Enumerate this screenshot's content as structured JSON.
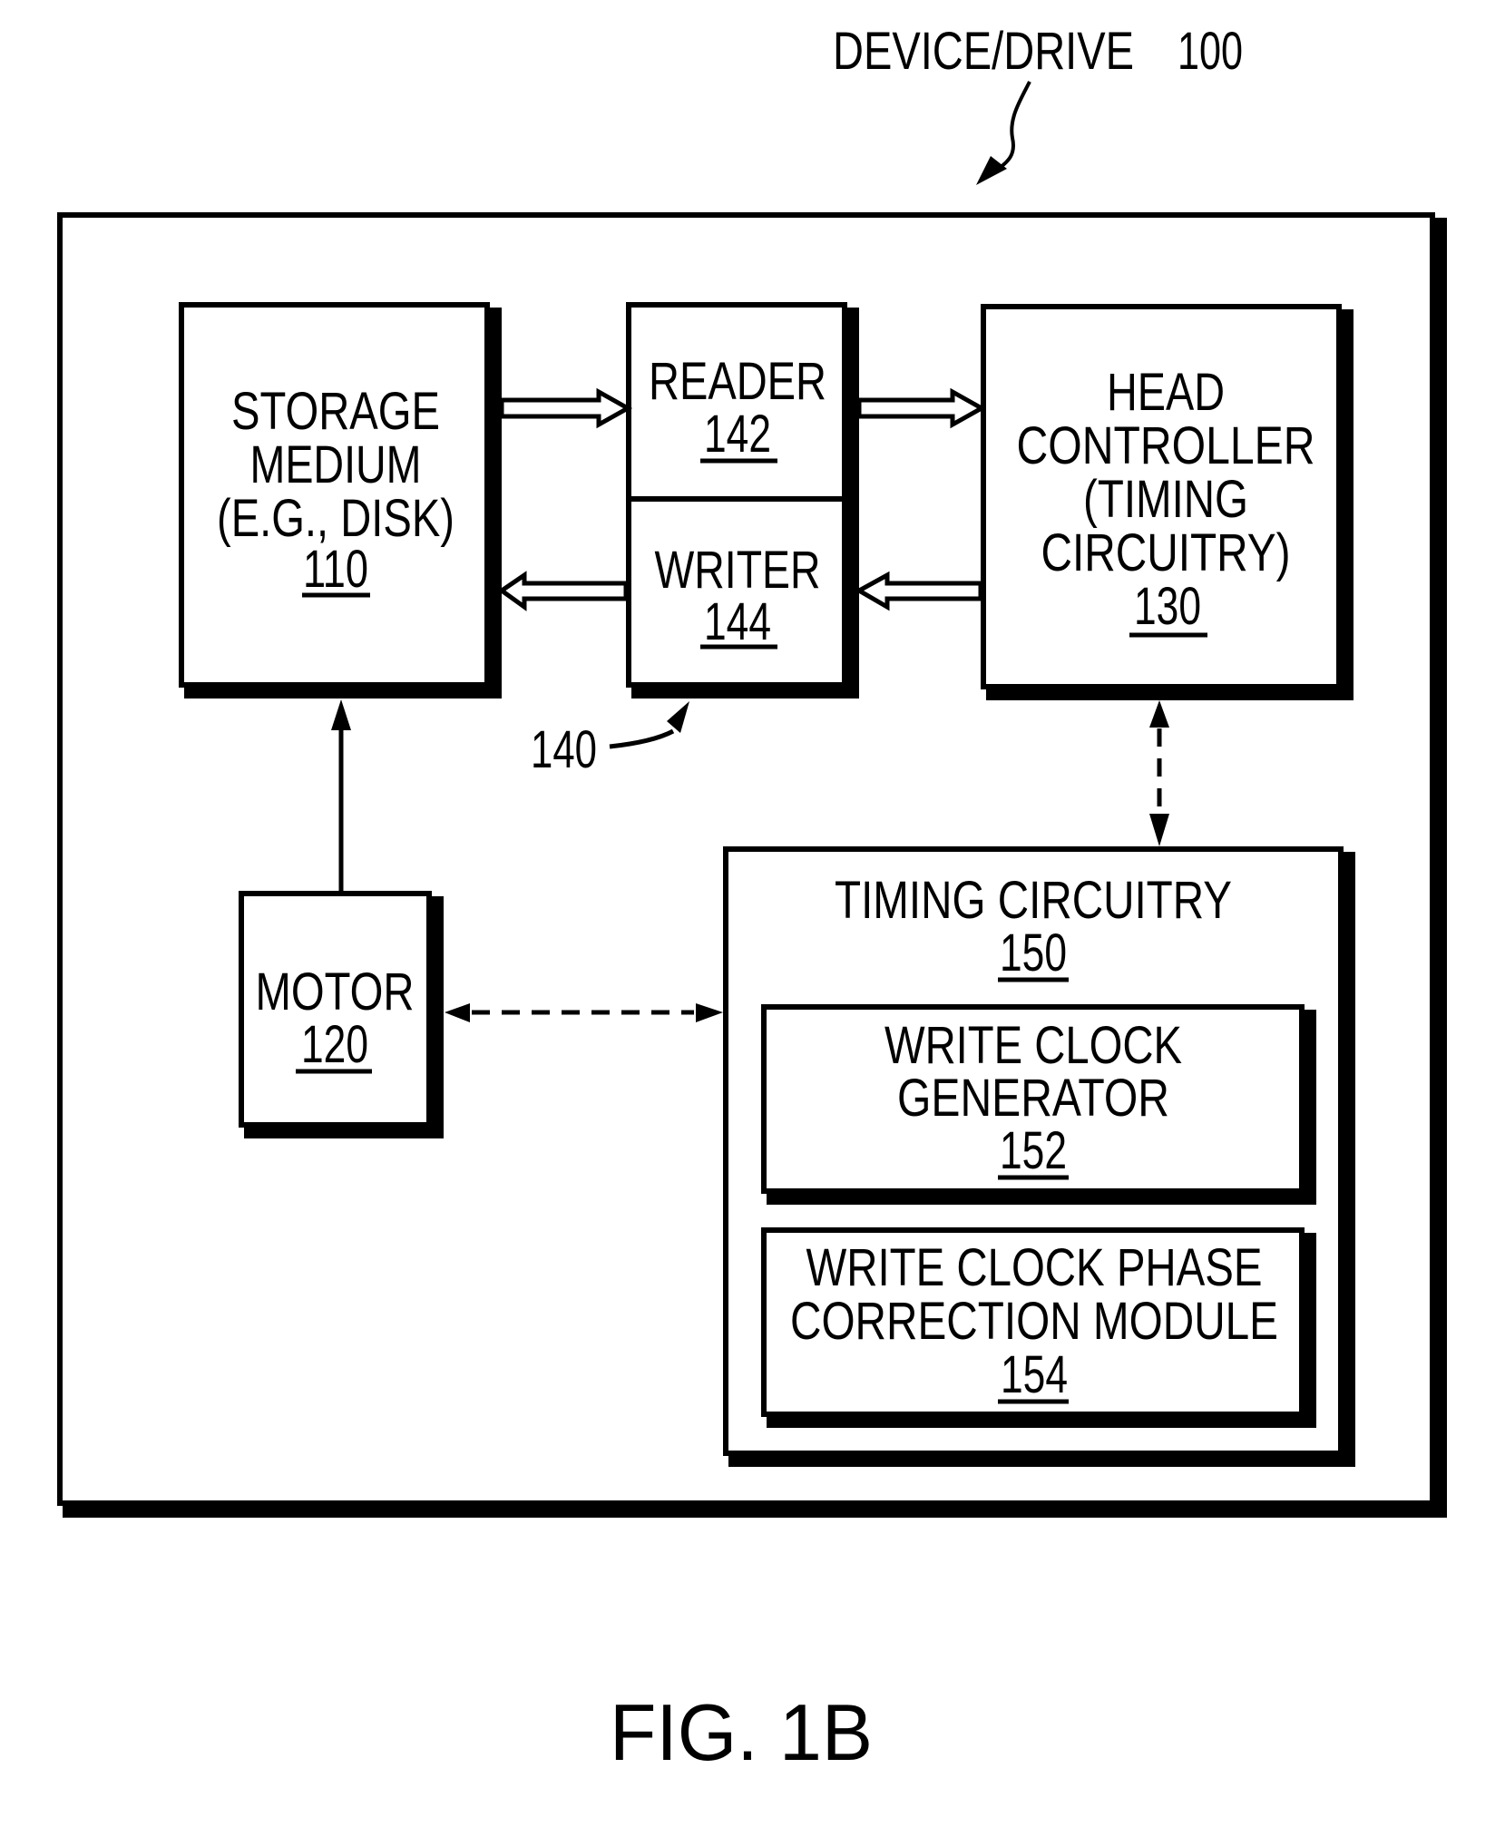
{
  "figure": {
    "caption": "FIG. 1B",
    "device_label": "DEVICE/DRIVE",
    "device_ref": "100",
    "assembly_ref": "140"
  },
  "blocks": {
    "storage": {
      "lines": [
        "STORAGE",
        "MEDIUM",
        "(E.G., DISK)"
      ],
      "ref": "110"
    },
    "reader": {
      "lines": [
        "READER"
      ],
      "ref": "142"
    },
    "writer": {
      "lines": [
        "WRITER"
      ],
      "ref": "144"
    },
    "head_controller": {
      "lines": [
        "HEAD",
        "CONTROLLER",
        "(TIMING",
        "CIRCUITRY)"
      ],
      "ref": "130"
    },
    "motor": {
      "lines": [
        "MOTOR"
      ],
      "ref": "120"
    },
    "timing_circuitry": {
      "lines": [
        "TIMING CIRCUITRY"
      ],
      "ref": "150"
    },
    "write_clock_generator": {
      "lines": [
        "WRITE CLOCK",
        "GENERATOR"
      ],
      "ref": "152"
    },
    "phase_correction": {
      "lines": [
        "WRITE CLOCK PHASE",
        "CORRECTION MODULE"
      ],
      "ref": "154"
    }
  },
  "connections": [
    {
      "from": "storage",
      "to": "reader",
      "style": "hollow-arrow"
    },
    {
      "from": "reader",
      "to": "head_controller",
      "style": "hollow-arrow"
    },
    {
      "from": "head_controller",
      "to": "writer",
      "style": "hollow-arrow"
    },
    {
      "from": "writer",
      "to": "storage",
      "style": "hollow-arrow"
    },
    {
      "from": "motor",
      "to": "storage",
      "style": "solid-arrow"
    },
    {
      "from": "motor",
      "to": "timing_circuitry",
      "style": "dashed-bidirectional"
    },
    {
      "from": "head_controller",
      "to": "timing_circuitry",
      "style": "dashed-bidirectional"
    }
  ]
}
